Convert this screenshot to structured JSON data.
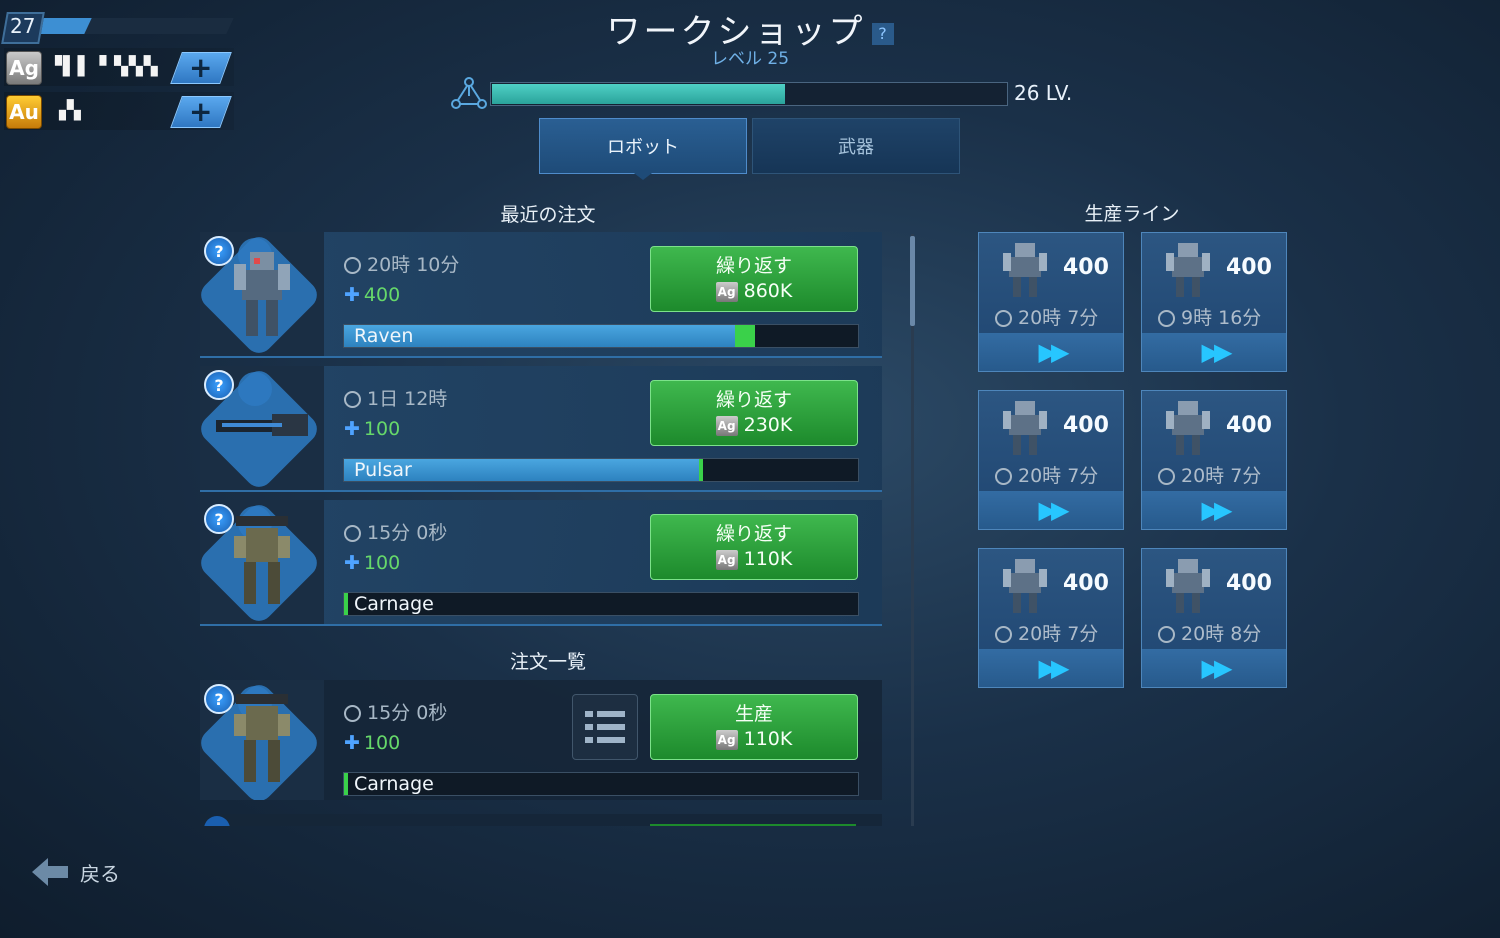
{
  "player": {
    "level": "27",
    "xp_fraction": 0.25,
    "silver": {
      "icon": "Ag",
      "amount": "▝▌▌▝ ▚▚▚"
    },
    "gold": {
      "icon": "Au",
      "amount": "▗▚"
    }
  },
  "header": {
    "title": "ワークショップ",
    "help": "?",
    "subtitle": "レベル 25",
    "progress_fraction": 0.57,
    "next_level": "26 LV."
  },
  "tabs": [
    {
      "label": "ロボット",
      "active": true
    },
    {
      "label": "武器",
      "active": false
    }
  ],
  "recent_orders": {
    "title": "最近の注文",
    "items": [
      {
        "time": "20時 10分",
        "points": "400",
        "name": "Raven",
        "progress": 0.76,
        "button_label": "繰り返す",
        "currency": "Ag",
        "price": "860K"
      },
      {
        "time": "1日 12時",
        "points": "100",
        "name": "Pulsar",
        "progress": 0.69,
        "button_label": "繰り返す",
        "currency": "Ag",
        "price": "230K"
      },
      {
        "time": "15分 0秒",
        "points": "100",
        "name": "Carnage",
        "progress": 0.0,
        "button_label": "繰り返す",
        "currency": "Ag",
        "price": "110K"
      }
    ]
  },
  "order_list": {
    "title": "注文一覧",
    "items": [
      {
        "time": "15分 0秒",
        "points": "100",
        "name": "Carnage",
        "progress": 0.0,
        "button_label": "生産",
        "currency": "Ag",
        "price": "110K"
      }
    ]
  },
  "production_line": {
    "title": "生産ライン",
    "slots": [
      {
        "points": "400",
        "time": "20時 7分"
      },
      {
        "points": "400",
        "time": "9時 16分"
      },
      {
        "points": "400",
        "time": "20時 7分"
      },
      {
        "points": "400",
        "time": "20時 7分"
      },
      {
        "points": "400",
        "time": "20時 7分"
      },
      {
        "points": "400",
        "time": "20時 8分"
      }
    ]
  },
  "footer": {
    "back_label": "戻る"
  },
  "colors": {
    "accent_teal": "#2aa39b",
    "button_green": "#1d8a2c",
    "progress_blue": "#2d82bf",
    "fast_forward": "#27c6ff"
  }
}
